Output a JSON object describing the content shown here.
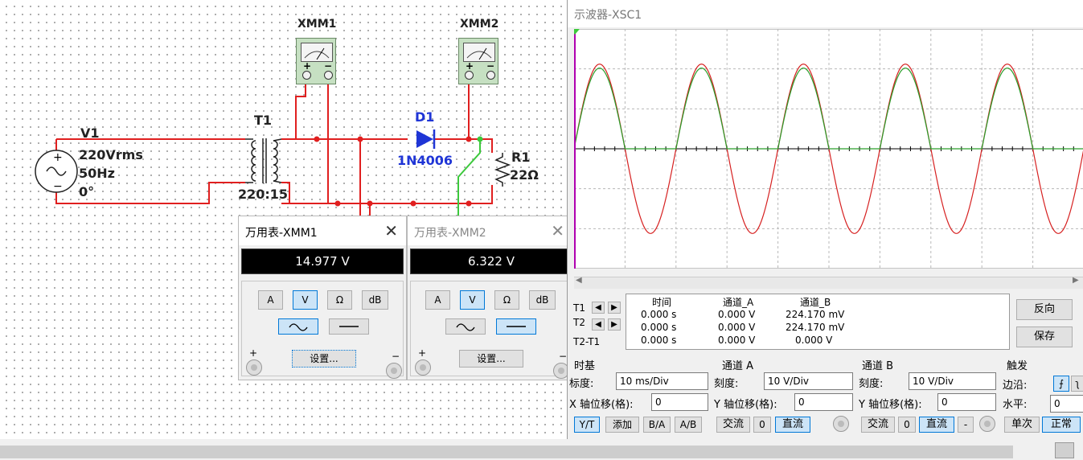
{
  "circuit": {
    "source": {
      "name": "V1",
      "voltage": "220Vrms",
      "freq": "50Hz",
      "phase": "0°"
    },
    "transformer": {
      "name": "T1",
      "ratio": "220:15"
    },
    "diode": {
      "name": "D1",
      "model": "1N4006"
    },
    "resistor": {
      "name": "R1",
      "value": "22Ω"
    },
    "meter1": {
      "name": "XMM1"
    },
    "meter2": {
      "name": "XMM2"
    }
  },
  "multimeter1": {
    "title": "万用表-XMM1",
    "reading": "14.977 V",
    "modes": [
      "A",
      "V",
      "Ω",
      "dB"
    ],
    "selected_mode": "V",
    "coupling_selected": "ac",
    "settings_label": "设置...",
    "plus": "+",
    "minus": "−"
  },
  "multimeter2": {
    "title": "万用表-XMM2",
    "reading": "6.322 V",
    "modes": [
      "A",
      "V",
      "Ω",
      "dB"
    ],
    "selected_mode": "V",
    "coupling_selected": "dc",
    "settings_label": "设置...",
    "plus": "+",
    "minus": "−"
  },
  "oscilloscope": {
    "title": "示波器-XSC1",
    "readout": {
      "headers": [
        "时间",
        "通道_A",
        "通道_B"
      ],
      "rows": [
        {
          "label": "T1",
          "time": "0.000 s",
          "a": "0.000 V",
          "b": "224.170 mV"
        },
        {
          "label": "T2",
          "time": "0.000 s",
          "a": "0.000 V",
          "b": "224.170 mV"
        },
        {
          "label": "T2-T1",
          "time": "0.000 s",
          "a": "0.000 V",
          "b": "0.000 V"
        }
      ]
    },
    "buttons": {
      "reverse": "反向",
      "save": "保存"
    },
    "timebase": {
      "title": "时基",
      "scale_label": "标度:",
      "scale_value": "10 ms/Div",
      "xoffset_label": "X 轴位移(格):",
      "xoffset_value": "0",
      "modes": [
        "Y/T",
        "添加",
        "B/A",
        "A/B"
      ],
      "selected_mode": "Y/T"
    },
    "channel_a": {
      "title": "通道 A",
      "scale_label": "刻度:",
      "scale_value": "10  V/Div",
      "yoffset_label": "Y 轴位移(格):",
      "yoffset_value": "0",
      "coupling": [
        "交流",
        "0",
        "直流"
      ],
      "selected": "直流"
    },
    "channel_b": {
      "title": "通道 B",
      "scale_label": "刻度:",
      "scale_value": "10  V/Div",
      "yoffset_label": "Y 轴位移(格):",
      "yoffset_value": "0",
      "coupling": [
        "交流",
        "0",
        "直流",
        "-"
      ],
      "selected": "直流"
    },
    "trigger": {
      "title": "触发",
      "edge_label": "边沿:",
      "level_label": "水平:",
      "level_value": "0",
      "modes": [
        "单次",
        "正常"
      ],
      "selected": "正常"
    },
    "traces": {
      "a_color": "#2a9d2a",
      "b_color": "#d62020",
      "cursor_color": "#b000b0"
    }
  },
  "chart_data": {
    "type": "line",
    "title": "",
    "xlabel": "",
    "ylabel": "",
    "x_unit": "ms",
    "xlim": [
      0,
      100
    ],
    "ylim": [
      -30,
      30
    ],
    "grid": true,
    "series": [
      {
        "name": "",
        "shape": "sine",
        "amplitude": 21.2,
        "freq_hz": 50,
        "color": "#d62020"
      },
      {
        "name": "",
        "shape": "half-wave rectified sine",
        "amplitude": 20.2,
        "freq_hz": 50,
        "color": "#2a9d2a"
      }
    ]
  }
}
